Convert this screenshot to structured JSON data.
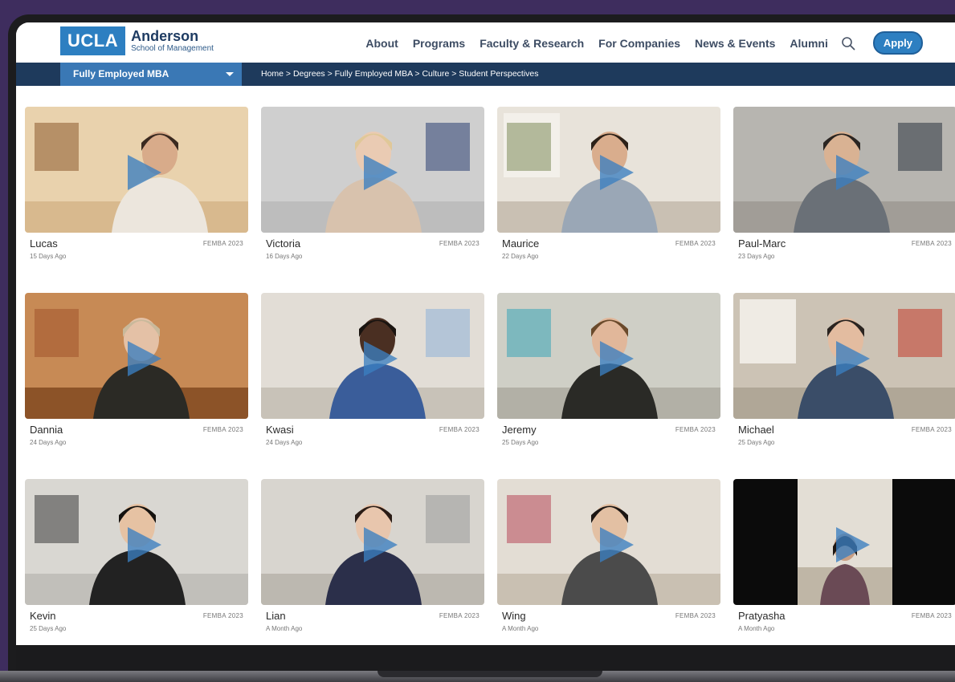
{
  "brand": {
    "logo_mark": "UCLA",
    "name": "Anderson",
    "subtitle": "School of Management"
  },
  "nav": {
    "items": [
      "About",
      "Programs",
      "Faculty & Research",
      "For Companies",
      "News & Events",
      "Alumni"
    ],
    "apply_label": "Apply"
  },
  "subnav": {
    "program_selected": "Fully Employed MBA",
    "breadcrumb": "Home > Degrees > Fully Employed MBA > Culture > Student Perspectives"
  },
  "colors": {
    "brand_blue": "#2d7fc1",
    "navy": "#1e3a5c",
    "play_overlay": "#3b7fc0"
  },
  "videos": [
    {
      "name": "Lucas",
      "date": "15 Days Ago",
      "tag": "FEMBA 2023"
    },
    {
      "name": "Victoria",
      "date": "16 Days Ago",
      "tag": "FEMBA 2023"
    },
    {
      "name": "Maurice",
      "date": "22 Days Ago",
      "tag": "FEMBA 2023"
    },
    {
      "name": "Paul-Marc",
      "date": "23 Days Ago",
      "tag": "FEMBA 2023"
    },
    {
      "name": "Dannia",
      "date": "24 Days Ago",
      "tag": "FEMBA 2023"
    },
    {
      "name": "Kwasi",
      "date": "24 Days Ago",
      "tag": "FEMBA 2023"
    },
    {
      "name": "Jeremy",
      "date": "25 Days Ago",
      "tag": "FEMBA 2023"
    },
    {
      "name": "Michael",
      "date": "25 Days Ago",
      "tag": "FEMBA 2023"
    },
    {
      "name": "Kevin",
      "date": "25 Days Ago",
      "tag": "FEMBA 2023"
    },
    {
      "name": "Lian",
      "date": "A Month Ago",
      "tag": "FEMBA 2023"
    },
    {
      "name": "Wing",
      "date": "A Month Ago",
      "tag": "FEMBA 2023"
    },
    {
      "name": "Pratyasha",
      "date": "A Month Ago",
      "tag": "FEMBA 2023"
    }
  ]
}
